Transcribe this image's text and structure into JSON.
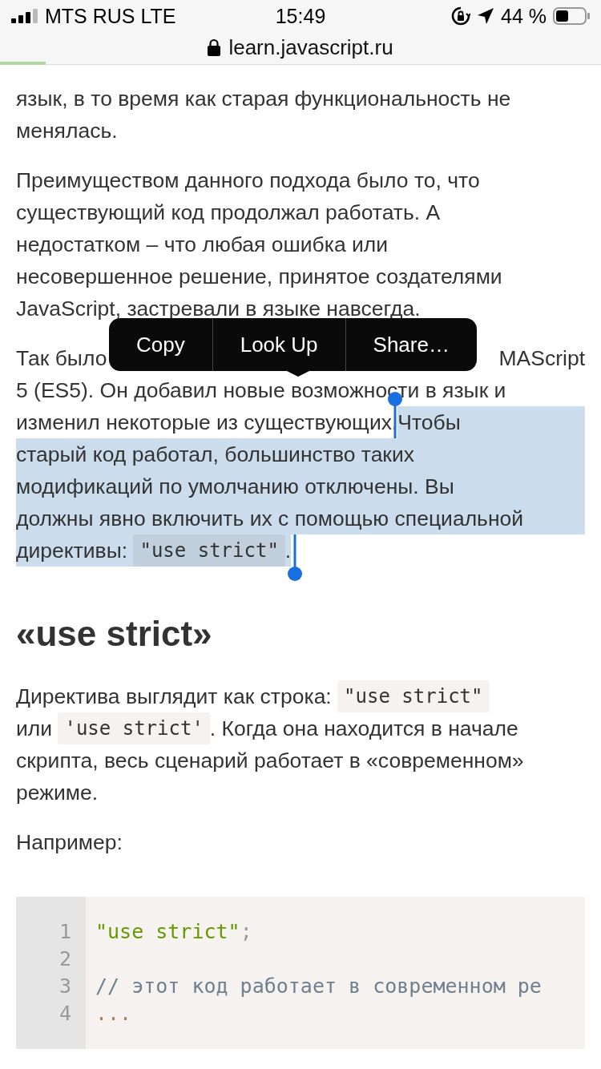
{
  "status_bar": {
    "carrier": "MTS RUS LTE",
    "time": "15:49",
    "battery": "44 %"
  },
  "address_bar": {
    "url": "learn.javascript.ru"
  },
  "reading_progress": {
    "level": 0.076
  },
  "article": [
    {
      "kind": "paragraph",
      "lines": [
        [
          {
            "kind": "text",
            "text": "язык, в то время как старая функциональность не",
            "selected": false
          }
        ],
        [
          {
            "kind": "text",
            "text": "менялась.",
            "selected": false
          }
        ]
      ]
    },
    {
      "kind": "paragraph",
      "lines": [
        [
          {
            "kind": "text",
            "text": "Преимуществом данного подхода было то, что",
            "selected": false
          }
        ],
        [
          {
            "kind": "text",
            "text": "существующий код продолжал работать. А",
            "selected": false
          }
        ],
        [
          {
            "kind": "text",
            "text": "недостатком – что любая ошибка или",
            "selected": false
          }
        ],
        [
          {
            "kind": "text",
            "text": "несовершенное решение, принятое создателями",
            "selected": false
          }
        ],
        [
          {
            "kind": "text",
            "text": "JavaScript, застревали в языке навсегда.",
            "selected": false
          }
        ]
      ]
    },
    {
      "kind": "paragraph",
      "menu": {
        "items": [
          "Copy",
          "Look Up",
          "Share…"
        ]
      },
      "lines": [
        [
          {
            "kind": "text",
            "text": "Так было",
            "selected": false
          },
          {
            "kind": "gap"
          },
          {
            "kind": "text",
            "text": "MAScript",
            "selected": false
          }
        ],
        [
          {
            "kind": "text",
            "text": "5 (ES5). Он добавил новые возможности в язык и",
            "selected": false
          }
        ],
        [
          {
            "kind": "text",
            "text": "изменил некоторые из существующих.",
            "selected": false
          },
          {
            "kind": "text",
            "text": "Чтобы",
            "selected": true
          }
        ],
        [
          {
            "kind": "text",
            "text": "старый код работал, большинство таких",
            "selected": true
          }
        ],
        [
          {
            "kind": "text",
            "text": "модификаций по умолчанию отключены. Вы",
            "selected": true
          }
        ],
        [
          {
            "kind": "text",
            "text": "должны явно включить их с помощью специальной",
            "selected": true
          }
        ],
        [
          {
            "kind": "text",
            "text": "директивы: ",
            "selected": true
          },
          {
            "kind": "code",
            "text": "\"use strict\"",
            "selected": true
          },
          {
            "kind": "text",
            "text": ".",
            "selected": true
          }
        ]
      ]
    },
    {
      "kind": "heading",
      "text": "«use strict»"
    },
    {
      "kind": "paragraph",
      "lines": [
        [
          {
            "kind": "text",
            "text": "Директива выглядит как строка: ",
            "selected": false
          },
          {
            "kind": "code",
            "text": "\"use strict\"",
            "selected": false
          }
        ],
        [
          {
            "kind": "text",
            "text": "или ",
            "selected": false
          },
          {
            "kind": "code",
            "text": "'use strict'",
            "selected": false
          },
          {
            "kind": "text",
            "text": ". Когда она находится в начале",
            "selected": false
          }
        ],
        [
          {
            "kind": "text",
            "text": "скрипта, весь сценарий работает в «современном»",
            "selected": false
          }
        ],
        [
          {
            "kind": "text",
            "text": "режиме.",
            "selected": false
          }
        ]
      ]
    },
    {
      "kind": "paragraph",
      "lines": [
        [
          {
            "kind": "text",
            "text": "Например:",
            "selected": false
          }
        ]
      ]
    },
    {
      "kind": "code_block",
      "lines": [
        {
          "number": "1",
          "tokens": [
            {
              "kind": "string",
              "text": "\"use strict\""
            },
            {
              "kind": "punctuation",
              "text": ";"
            }
          ]
        },
        {
          "number": "2"
        },
        {
          "number": "3",
          "tokens": [
            {
              "kind": "comment",
              "text": "// этот код работает в современном ре"
            }
          ]
        },
        {
          "number": "4",
          "tokens": [
            {
              "kind": "operator",
              "text": "..."
            }
          ]
        }
      ]
    }
  ]
}
